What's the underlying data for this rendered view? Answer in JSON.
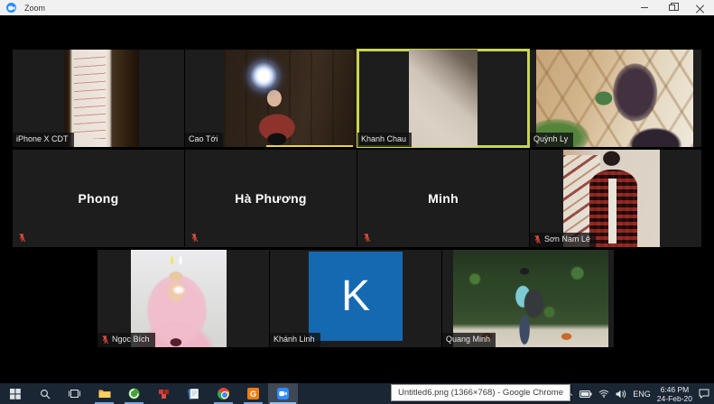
{
  "window": {
    "title": "Zoom"
  },
  "participants": [
    {
      "name": "iPhone X CDT",
      "camera": "on",
      "muted": false,
      "active_speaker": false,
      "scene": "handwritten math paper on wooden desk"
    },
    {
      "name": "Cao Tới",
      "camera": "on",
      "muted": false,
      "active_speaker": false,
      "scene": "toddler with bright headlamp in front of wooden door"
    },
    {
      "name": "Khanh Chau",
      "camera": "on",
      "muted": false,
      "active_speaker": true,
      "scene": "white wall with diagonal shadow"
    },
    {
      "name": "Quỳnh Ly",
      "camera": "on",
      "muted": false,
      "active_speaker": false,
      "scene": "girl with chin on hand, plants and wooden lattice"
    },
    {
      "name": "Phong",
      "camera": "off",
      "muted": true,
      "active_speaker": false
    },
    {
      "name": "Hà Phương",
      "camera": "off",
      "muted": true,
      "active_speaker": false
    },
    {
      "name": "Minh",
      "camera": "off",
      "muted": true,
      "active_speaker": false
    },
    {
      "name": "Sơn Nam Lê",
      "camera": "on",
      "muted": true,
      "active_speaker": false,
      "scene": "mirror selfie in red plaid shirt by staircase"
    },
    {
      "name": "Ngọc Bích",
      "camera": "on",
      "muted": true,
      "active_speaker": false,
      "scene": "girl in pink hood with bunny-ears filter"
    },
    {
      "name": "Khánh Linh",
      "camera": "off",
      "muted": false,
      "active_speaker": false,
      "avatar_letter": "K",
      "avatar_color": "#1569b1"
    },
    {
      "name": "Quang Minh",
      "camera": "on",
      "muted": false,
      "active_speaker": false,
      "scene": "person with backpack outdoors among foliage"
    }
  ],
  "active_speaker_border_color": "#c9d64f",
  "taskbar": {
    "icons": [
      "start",
      "search",
      "task-view",
      "file-explorer",
      "green-app",
      "red-app",
      "notes-app",
      "chrome",
      "g-app",
      "zoom"
    ],
    "g_app_letter": "G",
    "tray": {
      "language": "ENG",
      "time": "6:46 PM",
      "date": "24-Feb-20"
    }
  },
  "tooltip": {
    "text": "Untitled6.png (1366×768) - Google Chrome"
  }
}
